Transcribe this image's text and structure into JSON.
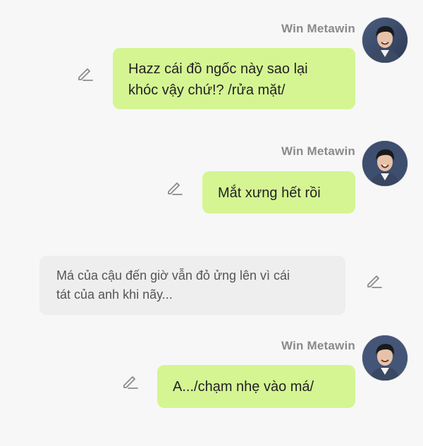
{
  "messages": [
    {
      "author": "Win Metawin",
      "text_line1": "Hazz cái đồ ngốc này sao lại",
      "text_line2": "khóc vậy chứ!? /rửa mặt/"
    },
    {
      "author": "Win Metawin",
      "text": "Mắt xưng hết rồi"
    },
    {
      "text_line1": "Má của cậu đến giờ vẫn đỏ ửng lên vì cái",
      "text_line2": "tát của anh khi nãy..."
    },
    {
      "author": "Win Metawin",
      "text": "A.../chạm nhẹ vào má/"
    }
  ],
  "icons": {
    "edit": "pencil-icon",
    "avatar": "avatar"
  },
  "colors": {
    "background": "#f7f7f7",
    "bubble_self": "#d5f593",
    "bubble_other": "#eeeeee",
    "author_name": "#8a8a8a",
    "icon": "#8c8c8c"
  }
}
